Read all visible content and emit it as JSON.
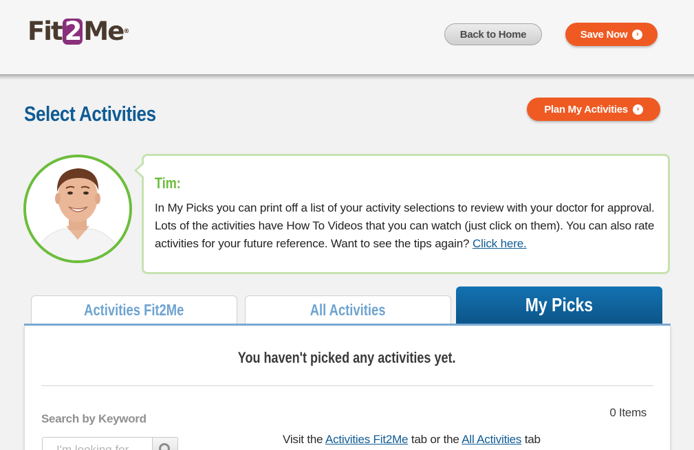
{
  "header": {
    "logo": {
      "part1": "Fit",
      "part2": "2",
      "part3": "Me",
      "tm": "®"
    },
    "back_home_label": "Back to Home",
    "save_now_label": "Save Now"
  },
  "page": {
    "title": "Select Activities",
    "plan_button_label": "Plan My Activities"
  },
  "coach": {
    "name": "Tim:",
    "message": "In My Picks you can print off a list of your activity selections to review with your doctor for approval. Lots of the activities have How To Videos that you can watch (just click on them). You can also rate activities for your future reference. Want to see the tips again?",
    "link_label": "Click here."
  },
  "tabs": [
    {
      "label": "Activities Fit2Me",
      "active": false
    },
    {
      "label": "All Activities",
      "active": false
    },
    {
      "label": "My Picks",
      "active": true
    }
  ],
  "panel": {
    "empty_message": "You haven't picked any activities yet.",
    "search_label": "Search by Keyword",
    "search_placeholder": "I'm looking for...",
    "items_count": "0 Items",
    "visit_text_1": "Visit the",
    "visit_link_1": "Activities Fit2Me",
    "visit_text_2": "tab or the",
    "visit_link_2": "All Activities",
    "visit_text_3": "tab"
  },
  "icons": {
    "arrow": "arrow-right-circle-icon",
    "search": "search-icon"
  },
  "colors": {
    "brand_brown": "#4a3a2e",
    "brand_purple": "#8a2f7c",
    "accent_orange": "#ef5a23",
    "title_blue": "#0f5b94",
    "coach_green": "#6cbd3c",
    "tab_inactive_text": "#6ea3d0"
  }
}
